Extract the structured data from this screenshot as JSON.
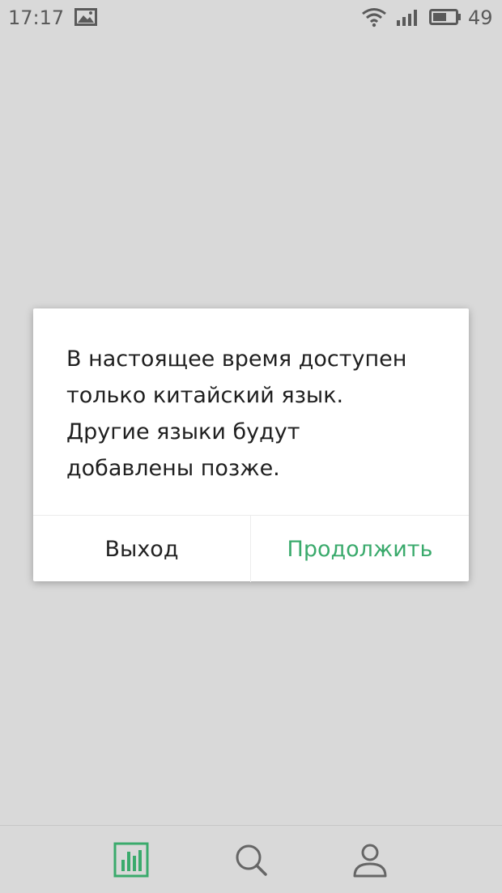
{
  "status_bar": {
    "time": "17:17",
    "battery_level": "49",
    "icons": [
      "gallery-icon",
      "wifi-icon",
      "signal-icon",
      "battery-icon"
    ]
  },
  "dialog": {
    "message": "В настоящее время доступен только китайский язык. Другие языки будут добавлены позже.",
    "message_lines": [
      "В настоящее время доступен",
      "только китайский язык.",
      "Другие языки будут",
      "добавлены позже."
    ],
    "exit_label": "Выход",
    "continue_label": "Продолжить"
  },
  "bottom_nav": {
    "items": [
      {
        "icon": "bar-chart-icon",
        "active": true
      },
      {
        "icon": "search-icon",
        "active": false
      },
      {
        "icon": "profile-icon",
        "active": false
      }
    ]
  },
  "colors": {
    "background": "#d9d9d9",
    "accent": "#3aaa6c",
    "dialog_bg": "#ffffff",
    "inactive_icon": "#666666"
  }
}
